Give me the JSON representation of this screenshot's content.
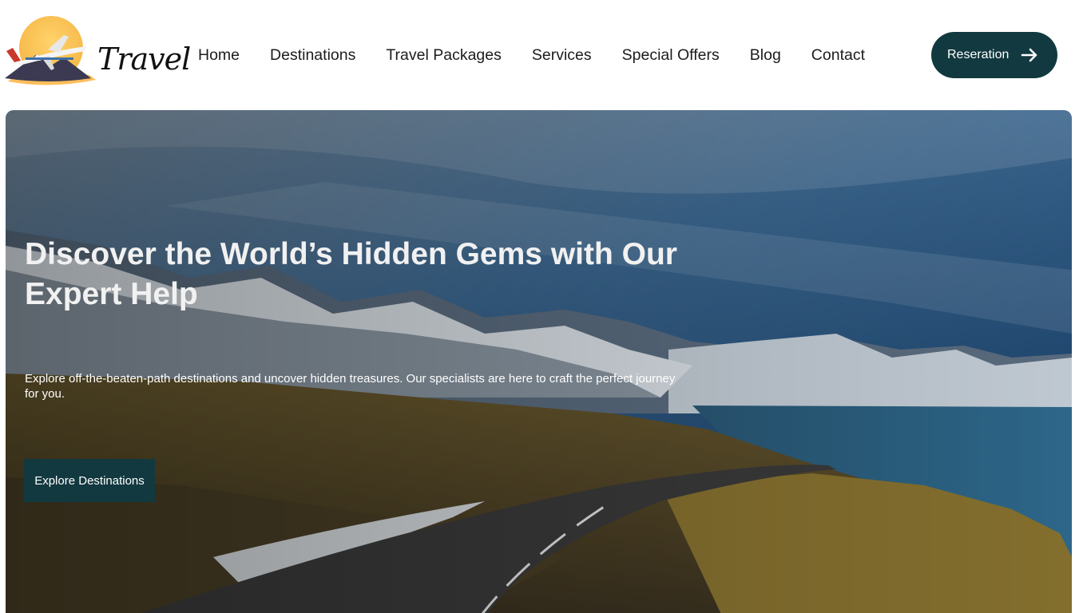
{
  "brand": {
    "name": "Travel"
  },
  "nav": {
    "items": [
      "Home",
      "Destinations",
      "Travel Packages",
      "Services",
      "Special Offers",
      "Blog",
      "Contact"
    ]
  },
  "header_cta": {
    "label": "Reseration",
    "icon": "arrow-right-icon"
  },
  "hero": {
    "title": "Discover the World’s Hidden Gems with Our Expert Help",
    "subtitle": "Explore off-the-beaten-path destinations and uncover hidden treasures. Our specialists are here to craft the perfect journey for you.",
    "button_label": "Explore Destinations"
  },
  "colors": {
    "primary": "#12393f",
    "text": "#1c1c1c",
    "background": "#ffffff"
  }
}
